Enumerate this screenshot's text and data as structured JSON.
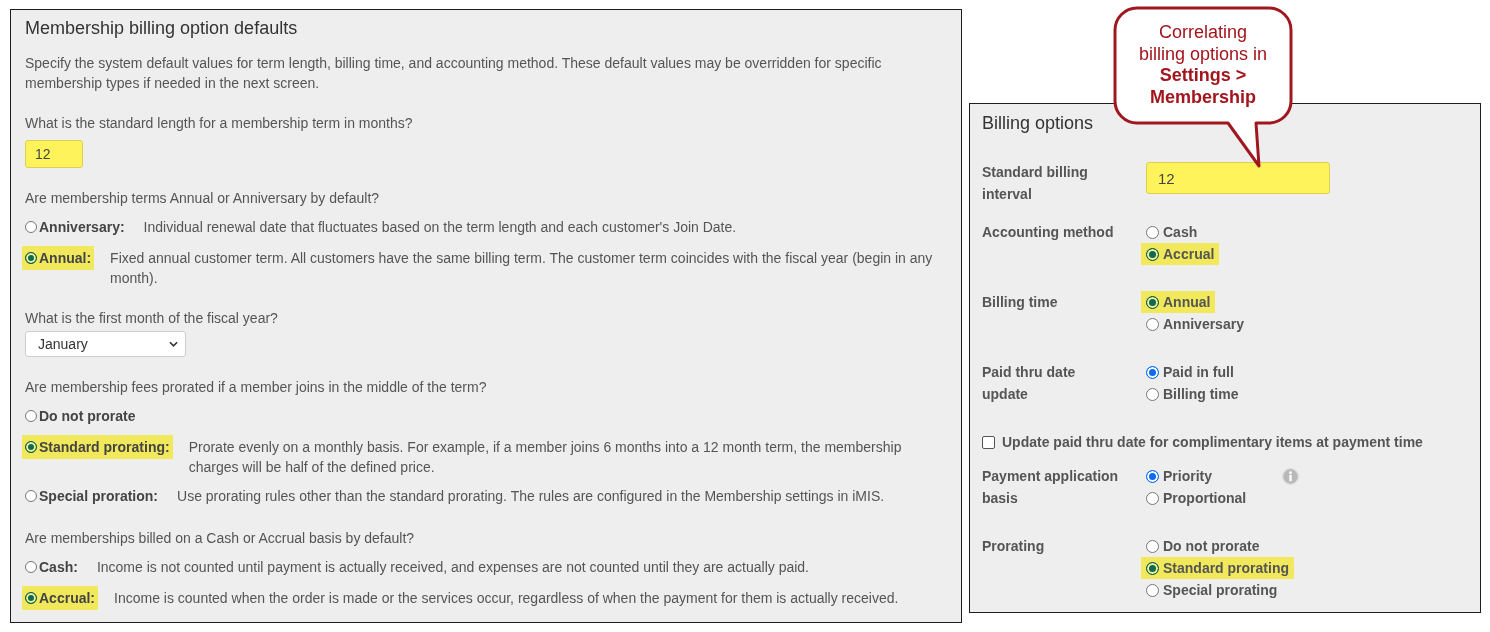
{
  "defaults_panel": {
    "title": "Membership billing option defaults",
    "intro": "Specify the system default values for term length, billing time, and accounting method. These default values may be overridden for specific membership types if needed in the next screen.",
    "questions": [
      {
        "kind": "text",
        "question": "What is the standard length for a membership term in months?",
        "value": "12",
        "highlighted": true
      },
      {
        "kind": "radio",
        "question": "Are membership terms Annual or Anniversary by default?",
        "options": [
          {
            "label": "Anniversary:",
            "description": "Individual renewal date that fluctuates based on the term length and each customer's Join Date.",
            "selected": false,
            "highlighted": false
          },
          {
            "label": "Annual:",
            "description": "Fixed annual customer term. All customers have the same billing term. The customer term coincides with the fiscal year (begin in any month).",
            "selected": true,
            "highlighted": true
          }
        ]
      },
      {
        "kind": "select",
        "question": "What is the first month of the fiscal year?",
        "value": "January"
      },
      {
        "kind": "radio",
        "question": "Are membership fees prorated if a member joins in the middle of the term?",
        "options": [
          {
            "label": "Do not prorate",
            "selected": false,
            "highlighted": false
          },
          {
            "label": "Standard prorating:",
            "description": "Prorate evenly on a monthly basis. For example, if a member joins 6 months into a 12 month term, the membership charges will be half of the defined price.",
            "selected": true,
            "highlighted": true
          },
          {
            "label": "Special proration:",
            "description": "Use prorating rules other than the standard prorating. The rules are configured in the Membership settings in iMIS.",
            "selected": false,
            "highlighted": false
          }
        ]
      },
      {
        "kind": "radio",
        "question": "Are memberships billed on a Cash or Accrual basis by default?",
        "options": [
          {
            "label": "Cash:",
            "description": "Income is not counted until payment is actually received, and expenses are not counted until they are actually paid.",
            "selected": false,
            "highlighted": false
          },
          {
            "label": "Accrual:",
            "description": "Income is counted when the order is made or the services occur, regardless of when the payment for them is actually received.",
            "selected": true,
            "highlighted": true
          }
        ]
      }
    ]
  },
  "callout": {
    "text": "Correlating billing options in **Settings > Membership**"
  },
  "billing_options_panel": {
    "title": "Billing options",
    "rows": [
      {
        "kind": "text",
        "label": "Standard billing interval",
        "value": "12",
        "highlighted": true
      },
      {
        "kind": "radio",
        "label": "Accounting method",
        "options": [
          {
            "label": "Cash",
            "selected": false,
            "highlighted": false
          },
          {
            "label": "Accrual",
            "selected": true,
            "highlighted": true
          }
        ]
      },
      {
        "kind": "radio",
        "label": "Billing time",
        "options": [
          {
            "label": "Annual",
            "selected": true,
            "highlighted": true
          },
          {
            "label": "Anniversary",
            "selected": false,
            "highlighted": false
          }
        ]
      },
      {
        "kind": "radio",
        "label": "Paid thru date update",
        "options": [
          {
            "label": "Paid in full",
            "selected": true,
            "highlighted": false
          },
          {
            "label": "Billing time",
            "selected": false,
            "highlighted": false
          }
        ]
      },
      {
        "kind": "checkbox",
        "label": "Update paid thru date for complimentary items at payment time",
        "checked": false
      },
      {
        "kind": "radio",
        "label": "Payment application basis",
        "info_icon": true,
        "options": [
          {
            "label": "Priority",
            "selected": true,
            "highlighted": false
          },
          {
            "label": "Proportional",
            "selected": false,
            "highlighted": false
          }
        ]
      },
      {
        "kind": "radio",
        "label": "Prorating",
        "options": [
          {
            "label": "Do not prorate",
            "selected": false,
            "highlighted": false
          },
          {
            "label": "Standard prorating",
            "selected": true,
            "highlighted": true
          },
          {
            "label": "Special prorating",
            "selected": false,
            "highlighted": false
          }
        ]
      }
    ]
  }
}
